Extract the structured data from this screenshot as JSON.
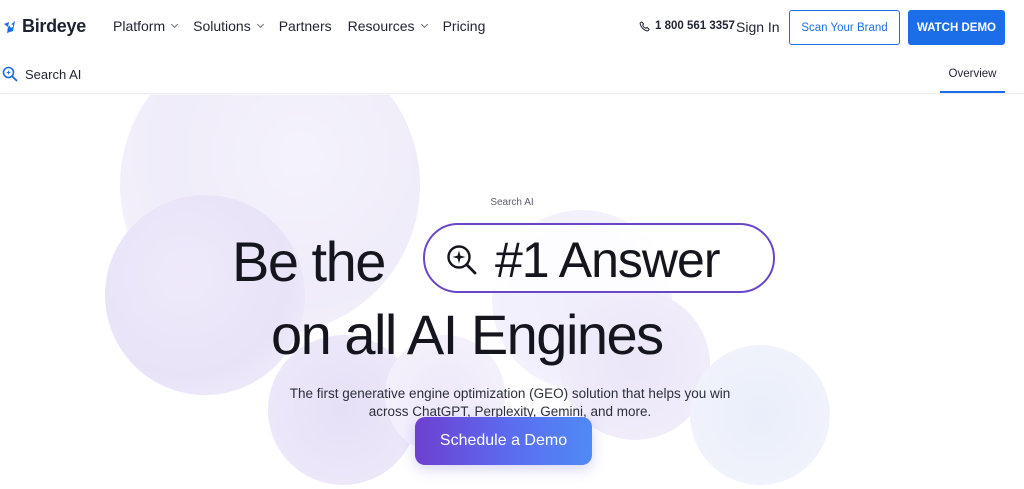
{
  "brand": {
    "name": "Birdeye",
    "accent": "#1c6ee8"
  },
  "nav": {
    "items": [
      {
        "label": "Platform",
        "has_dropdown": true
      },
      {
        "label": "Solutions",
        "has_dropdown": true
      },
      {
        "label": "Partners",
        "has_dropdown": false
      },
      {
        "label": "Resources",
        "has_dropdown": true
      },
      {
        "label": "Pricing",
        "has_dropdown": false
      }
    ],
    "phone": "1 800 561 3357",
    "signin": "Sign In",
    "scan_brand": "Scan Your Brand",
    "watch_demo": "WATCH DEMO"
  },
  "subnav": {
    "title": "Search AI",
    "icon": "search-icon",
    "tab": "Overview"
  },
  "hero": {
    "eyebrow": "Search AI",
    "headline_start": "Be the",
    "headline_highlight": "#1 Answer",
    "headline_end": "on all AI Engines",
    "highlight_icon": "sparkle-search-icon",
    "description": "The first generative engine optimization (GEO) solution that helps you win across ChatGPT, Perplexity, Gemini, and more.",
    "cta": "Schedule a Demo",
    "highlight_border_color": "#6a46c9"
  }
}
